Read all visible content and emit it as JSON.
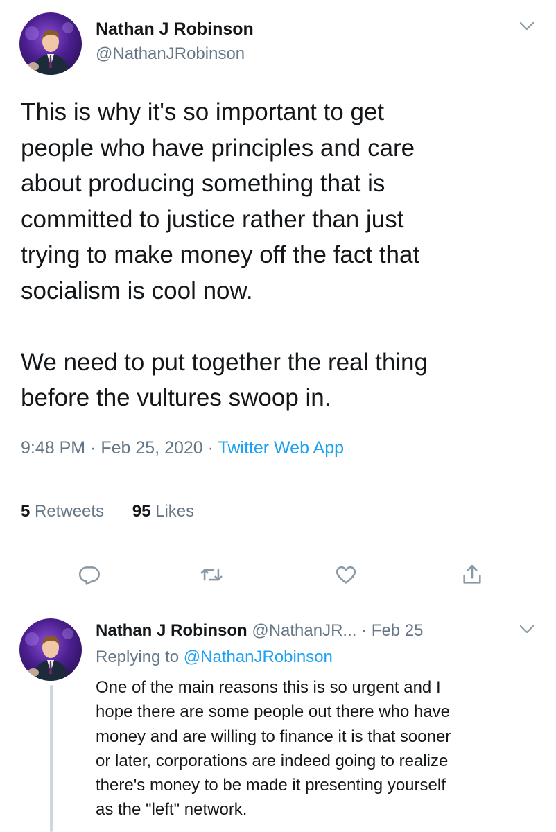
{
  "main_tweet": {
    "display_name": "Nathan J Robinson",
    "handle": "@NathanJRobinson",
    "text": "This is why it's so important to get\npeople who have principles and care\nabout producing something that is\ncommitted to justice rather than just\ntrying to make money off the fact that\nsocialism is cool now.\n\nWe need to put together the real thing\nbefore the vultures swoop in.",
    "time": "9:48 PM",
    "date": "Feb 25, 2020",
    "separator": "·",
    "source": "Twitter Web App",
    "retweets_count": "5",
    "retweets_label": "Retweets",
    "likes_count": "95",
    "likes_label": "Likes",
    "actions": [
      "reply-icon",
      "retweet-icon",
      "like-icon",
      "share-icon"
    ]
  },
  "reply_tweet": {
    "display_name": "Nathan J Robinson",
    "handle": "@NathanJR...",
    "separator": "·",
    "date": "Feb 25",
    "replying_label": "Replying to",
    "replying_to": "@NathanJRobinson",
    "text": "One of the main reasons this is so urgent and I\nhope there are some people out there who have\nmoney and are willing to finance it is that sooner\nor later, corporations are indeed going to realize\nthere's money to be made it presenting yourself\nas the \"left\" network."
  },
  "colors": {
    "text_primary": "#14171a",
    "text_secondary": "#657786",
    "link": "#1da1f2",
    "divider": "#dfe3e7"
  }
}
